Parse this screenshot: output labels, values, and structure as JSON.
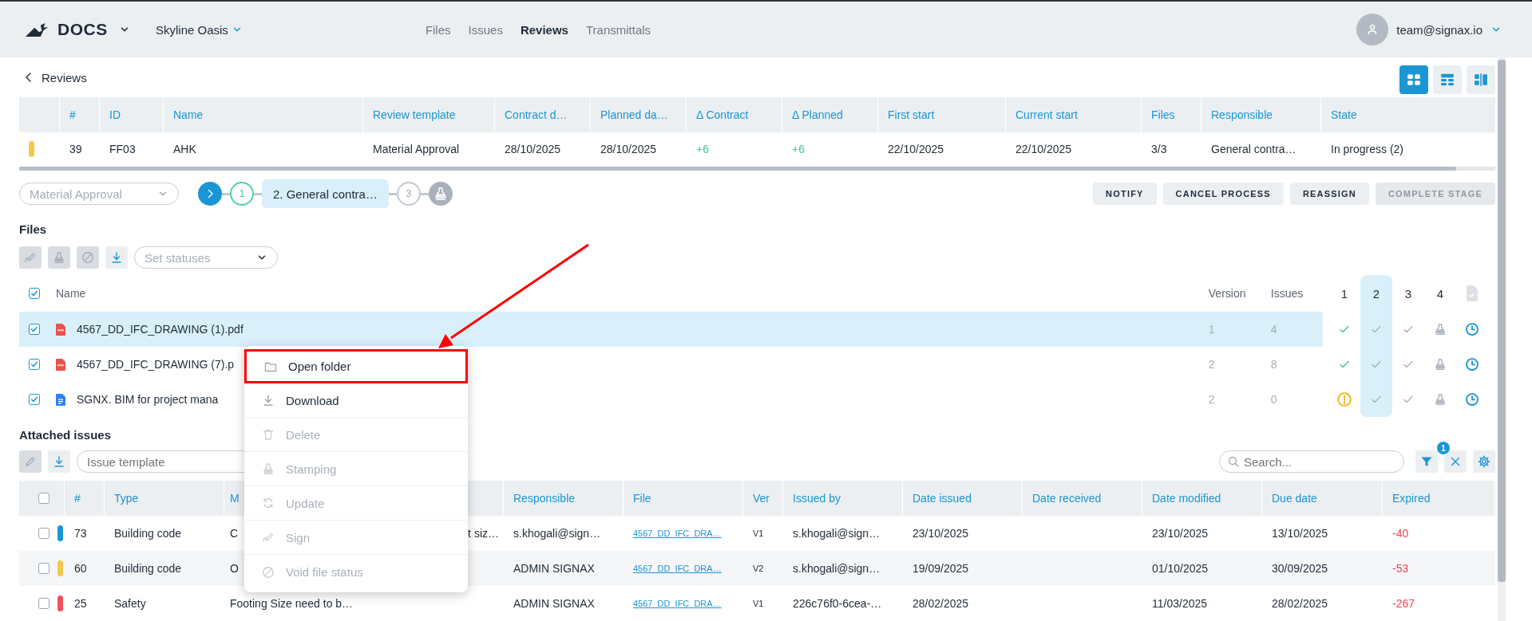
{
  "header": {
    "logo": "DOCS",
    "project": "Skyline Oasis",
    "nav": [
      {
        "label": "Files",
        "selected": false
      },
      {
        "label": "Issues",
        "selected": false
      },
      {
        "label": "Reviews",
        "selected": true
      },
      {
        "label": "Transmittals",
        "selected": false
      }
    ],
    "user": "team@signax.io"
  },
  "back_link": "Reviews",
  "view_toggles": [
    {
      "kind": "grid",
      "selected": true
    },
    {
      "kind": "rows",
      "selected": false
    },
    {
      "kind": "split",
      "selected": false
    }
  ],
  "reviews_table": {
    "columns": [
      "#",
      "ID",
      "Name",
      "Review template",
      "Contract d…",
      "Planned da…",
      "Δ Contract",
      "Δ Planned",
      "First start",
      "Current start",
      "Files",
      "Responsible",
      "State"
    ],
    "rows": [
      {
        "color": "#f2c94c",
        "cells": [
          "39",
          "FF03",
          "AHK",
          "Material Approval",
          "28/10/2025",
          "28/10/2025",
          "+6",
          "+6",
          "22/10/2025",
          "22/10/2025",
          "3/3",
          "General contra…",
          "In progress (2)"
        ]
      }
    ]
  },
  "stepper": {
    "template": "Material Approval",
    "steps": [
      {
        "kind": "next"
      },
      {
        "kind": "done",
        "label": "1"
      },
      {
        "kind": "current",
        "label": "2. General contra…"
      },
      {
        "kind": "pending",
        "label": "3"
      },
      {
        "kind": "stamp"
      }
    ]
  },
  "actions": [
    {
      "label": "NOTIFY",
      "disabled": false
    },
    {
      "label": "CANCEL PROCESS",
      "disabled": false
    },
    {
      "label": "REASSIGN",
      "disabled": false
    },
    {
      "label": "COMPLETE STAGE",
      "disabled": true
    }
  ],
  "files": {
    "title": "Files",
    "tools": [
      {
        "kind": "sign",
        "disabled": true
      },
      {
        "kind": "stamp",
        "disabled": true
      },
      {
        "kind": "void",
        "disabled": true
      },
      {
        "kind": "download",
        "disabled": false
      }
    ],
    "status_select": {
      "placeholder": "Set statuses"
    },
    "all_checked": true,
    "columns": {
      "name": "Name",
      "version": "Version",
      "issues": "Issues"
    },
    "stage_columns": [
      {
        "label": "1",
        "selected": false
      },
      {
        "label": "2",
        "selected": true
      },
      {
        "label": "3",
        "selected": false
      },
      {
        "label": "4",
        "selected": false
      }
    ],
    "rows": [
      {
        "kind": "pdf",
        "name": "4567_DD_IFC_DRAWING (1).pdf",
        "checked": true,
        "selected": true,
        "version": "1",
        "issues": "4",
        "stages": [
          {
            "kind": "approved"
          },
          {
            "kind": "pending"
          },
          {
            "kind": "pending"
          },
          {
            "kind": "stamp"
          },
          {
            "kind": "clock"
          }
        ]
      },
      {
        "kind": "pdf",
        "name": "4567_DD_IFC_DRAWING (7).p",
        "checked": true,
        "selected": false,
        "version": "2",
        "issues": "8",
        "stages": [
          {
            "kind": "approved"
          },
          {
            "kind": "pending"
          },
          {
            "kind": "pending"
          },
          {
            "kind": "stamp"
          },
          {
            "kind": "clock"
          }
        ]
      },
      {
        "kind": "doc",
        "name": "SGNX. BIM for project mana",
        "checked": true,
        "selected": false,
        "version": "2",
        "issues": "0",
        "stages": [
          {
            "kind": "warning"
          },
          {
            "kind": "pending"
          },
          {
            "kind": "pending"
          },
          {
            "kind": "stamp"
          },
          {
            "kind": "clock"
          }
        ]
      }
    ]
  },
  "context_menu": {
    "items": [
      {
        "kind": "folder",
        "label": "Open folder",
        "disabled": false,
        "highlighted": true
      },
      {
        "kind": "download",
        "label": "Download",
        "disabled": false,
        "highlighted": false
      },
      {
        "kind": "trash",
        "label": "Delete",
        "disabled": true,
        "highlighted": false
      },
      {
        "kind": "stamp",
        "label": "Stamping",
        "disabled": true,
        "highlighted": false
      },
      {
        "kind": "update",
        "label": "Update",
        "disabled": true,
        "highlighted": false
      },
      {
        "kind": "sign",
        "label": "Sign",
        "disabled": true,
        "highlighted": false
      },
      {
        "kind": "void",
        "label": "Void file status",
        "disabled": true,
        "highlighted": false
      }
    ]
  },
  "issues": {
    "title": "Attached issues",
    "tools": [
      {
        "kind": "edit",
        "disabled": true
      },
      {
        "kind": "download",
        "disabled": false
      }
    ],
    "template_select": {
      "placeholder": "Issue template"
    },
    "search": {
      "placeholder": "Search..."
    },
    "filter_count": "1",
    "all_checked": false,
    "columns": [
      "#",
      "Type",
      "M",
      "Responsible",
      "File",
      "Ver",
      "Issued by",
      "Date issued",
      "Date received",
      "Date modified",
      "Due date",
      "Expired"
    ],
    "rows": [
      {
        "checked": false,
        "color": "#1a96d4",
        "number": "73",
        "type": "Building code",
        "column_4": "C",
        "column_4_end": "t siz…",
        "responsible": "s.khogali@sign…",
        "file": "4567_DD_IFC_DRA…",
        "version": "V1",
        "issued_by": "s.khogali@sign…",
        "date_issued": "23/10/2025",
        "date_modified": "23/10/2025",
        "due_date": "13/10/2025",
        "expired": "-40"
      },
      {
        "checked": false,
        "color": "#f2c94c",
        "number": "60",
        "type": "Building code",
        "column_4": "O",
        "responsible": "ADMIN SIGNAX",
        "file": "4567_DD_IFC_DRA…",
        "version": "V2",
        "issued_by": "s.khogali@sign…",
        "date_issued": "19/09/2025",
        "date_modified": "01/10/2025",
        "due_date": "30/09/2025",
        "expired": "-53"
      },
      {
        "checked": false,
        "color": "#f0515b",
        "number": "25",
        "type": "Safety",
        "column_4": "Footing Size need to b…",
        "responsible": "ADMIN SIGNAX",
        "file": "4567_DD_IFC_DRA…",
        "version": "V1",
        "issued_by": "226c76f0-6cea-…",
        "date_issued": "28/02/2025",
        "date_modified": "11/03/2025",
        "due_date": "28/02/2025",
        "expired": "-267"
      }
    ]
  }
}
